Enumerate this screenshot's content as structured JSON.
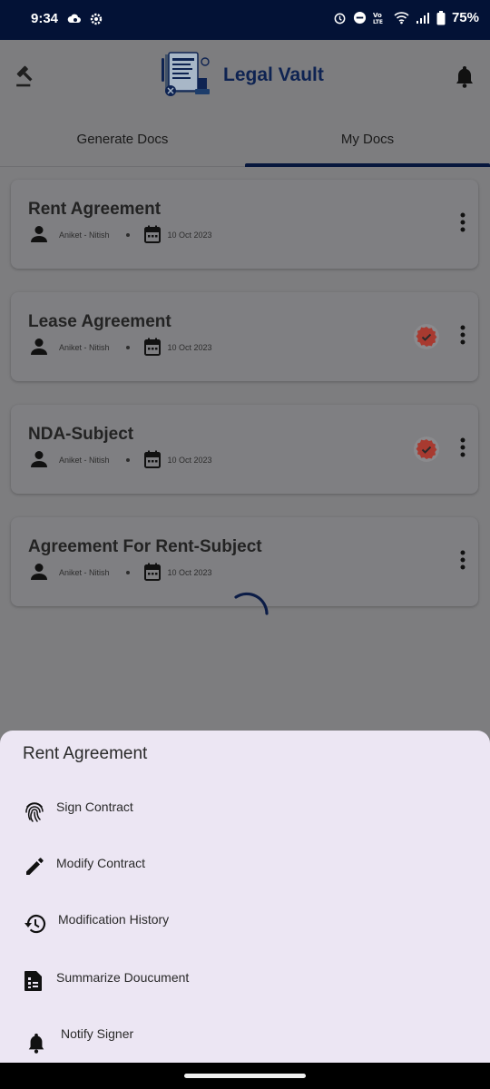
{
  "status_bar": {
    "time": "9:34",
    "battery": "75%",
    "network": "Vo LTE"
  },
  "app": {
    "title": "Legal Vault"
  },
  "tabs": [
    {
      "label": "Generate Docs",
      "selected": false
    },
    {
      "label": "My Docs",
      "selected": true
    }
  ],
  "documents": [
    {
      "title": "Rent Agreement",
      "parties": "Aniket - Nitish",
      "date": "10 Oct 2023",
      "verified": false
    },
    {
      "title": "Lease Agreement",
      "parties": "Aniket - Nitish",
      "date": "10 Oct 2023",
      "verified": true
    },
    {
      "title": "NDA-Subject",
      "parties": "Aniket - Nitish",
      "date": "10 Oct 2023",
      "verified": true
    },
    {
      "title": "Agreement For Rent-Subject",
      "parties": "Aniket - Nitish",
      "date": "10 Oct 2023",
      "verified": false
    }
  ],
  "sheet": {
    "title": "Rent Agreement",
    "items": [
      {
        "label": "Sign Contract",
        "icon": "fingerprint-icon"
      },
      {
        "label": "Modify Contract",
        "icon": "pencil-icon"
      },
      {
        "label": "Modification History",
        "icon": "history-icon"
      },
      {
        "label": "Summarize Doucument",
        "icon": "summary-icon"
      },
      {
        "label": "Notify Signer",
        "icon": "bell-icon"
      }
    ]
  },
  "colors": {
    "status_bar": "#031236",
    "brand": "#0e2352",
    "scrim": "#7d7d7f",
    "sheet": "#ece6f3",
    "badge": "#c0392b"
  }
}
